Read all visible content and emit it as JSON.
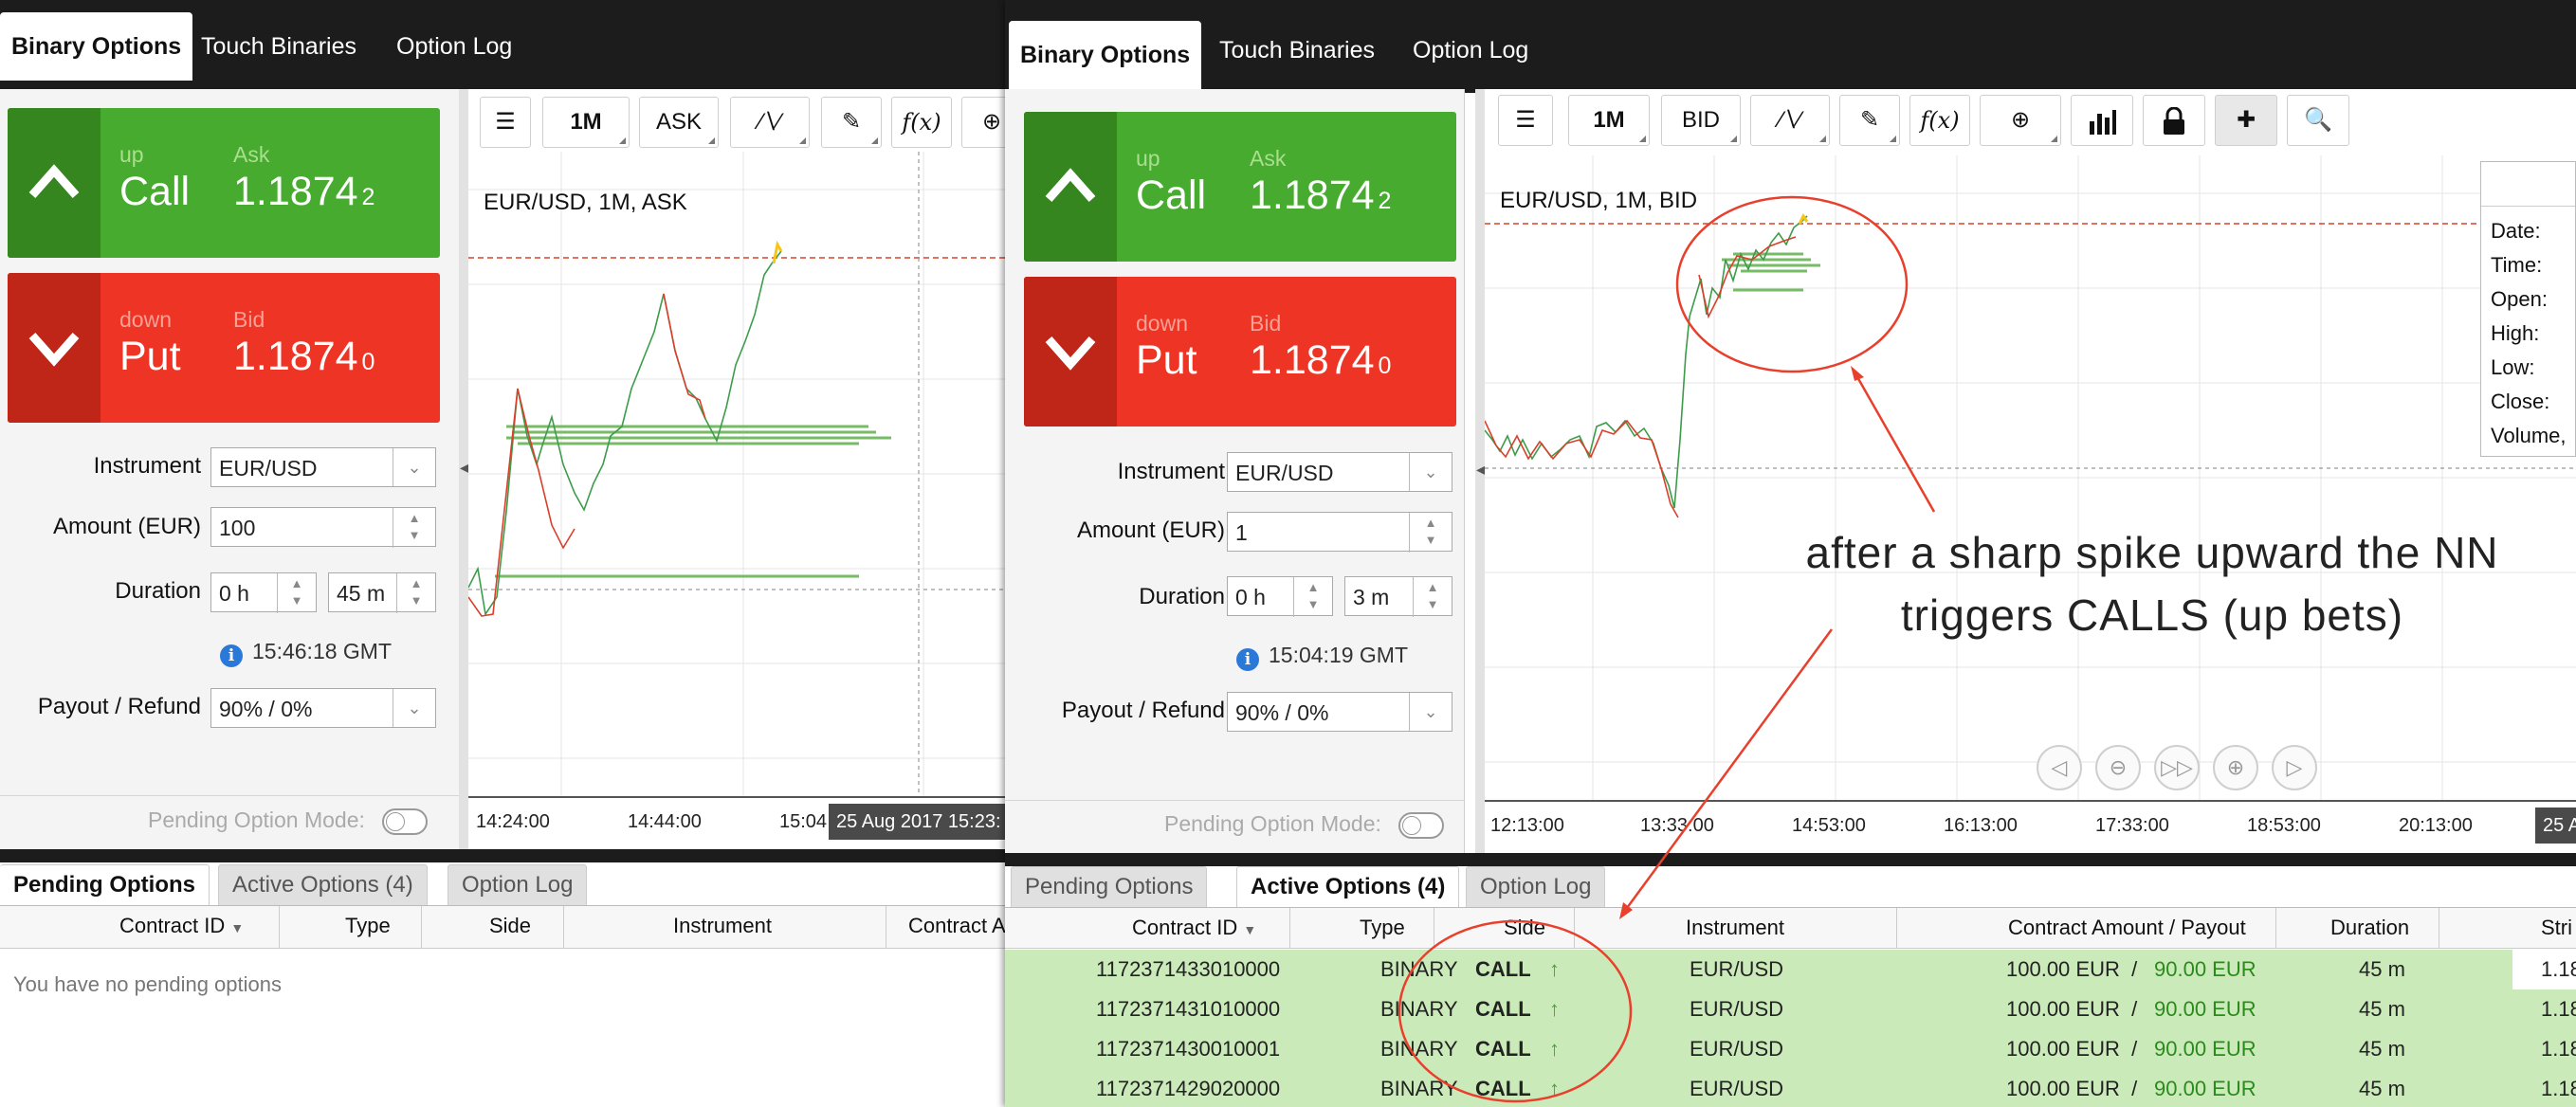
{
  "annotation": {
    "line1": "after a sharp spike upward the NN",
    "line2": "triggers CALLS (up  bets)"
  },
  "colors": {
    "call_green": "#46ab2e",
    "put_red": "#ee3424",
    "active_row": "#cbeaba",
    "annotation_red": "#e8402c"
  },
  "left": {
    "tabs": [
      "Binary Options",
      "Touch Binaries",
      "Option Log"
    ],
    "call": {
      "small_label": "up",
      "label": "Call",
      "price_label": "Ask",
      "price": "1.1874",
      "price_sub": "2"
    },
    "put": {
      "small_label": "down",
      "label": "Put",
      "price_label": "Bid",
      "price": "1.1874",
      "price_sub": "0"
    },
    "form": {
      "instrument_label": "Instrument",
      "instrument": "EUR/USD",
      "amount_label": "Amount (EUR)",
      "amount": "100",
      "duration_label": "Duration",
      "hours": "0 h",
      "minutes": "45 m",
      "time": "15:46:18 GMT",
      "payout_label": "Payout / Refund",
      "payout": "90% / 0%",
      "pending_mode": "Pending Option Mode:"
    },
    "chart": {
      "title": "EUR/USD, 1M, ASK",
      "toolbar": {
        "interval": "1M",
        "price_type": "ASK",
        "line_icon": "line-style-icon",
        "draw_icon": "pencil-icon",
        "func_label": "f(x)"
      },
      "x_labels": [
        "14:24:00",
        "14:44:00",
        "15:04"
      ],
      "date_box": "25 Aug 2017 15:23:"
    },
    "bottom": {
      "tabs": [
        "Pending Options",
        "Active Options (4)",
        "Option Log"
      ],
      "columns": [
        "Contract ID",
        "Type",
        "Side",
        "Instrument",
        "Contract A"
      ],
      "empty": "You have no pending options"
    }
  },
  "right": {
    "tabs": [
      "Binary Options",
      "Touch Binaries",
      "Option Log"
    ],
    "call": {
      "small_label": "up",
      "label": "Call",
      "price_label": "Ask",
      "price": "1.1874",
      "price_sub": "2"
    },
    "put": {
      "small_label": "down",
      "label": "Put",
      "price_label": "Bid",
      "price": "1.1874",
      "price_sub": "0"
    },
    "form": {
      "instrument_label": "Instrument",
      "instrument": "EUR/USD",
      "amount_label": "Amount (EUR)",
      "amount": "1",
      "duration_label": "Duration",
      "hours": "0 h",
      "minutes": "3 m",
      "time": "15:04:19 GMT",
      "payout_label": "Payout / Refund",
      "payout": "90% / 0%",
      "pending_mode": "Pending Option Mode:"
    },
    "chart": {
      "title": "EUR/USD, 1M, BID",
      "toolbar": {
        "interval": "1M",
        "price_type": "BID",
        "func_label": "f(x)"
      },
      "x_labels": [
        "12:13:00",
        "13:33:00",
        "14:53:00",
        "16:13:00",
        "17:33:00",
        "18:53:00",
        "20:13:00"
      ],
      "date_box": "25 A",
      "info_labels": [
        "Date:",
        "Time:",
        "Open:",
        "High:",
        "Low:",
        "Close:",
        "Volume,"
      ]
    },
    "bottom": {
      "tabs": [
        "Pending Options",
        "Active Options (4)",
        "Option Log"
      ],
      "columns": [
        "Contract ID",
        "Type",
        "Side",
        "Instrument",
        "Contract Amount / Payout",
        "Duration",
        "Stri"
      ],
      "rows": [
        {
          "id": "1172371433010000",
          "type": "BINARY",
          "side": "CALL",
          "instrument": "EUR/USD",
          "amount": "100.00 EUR",
          "payout": "90.00 EUR",
          "duration": "45 m",
          "strike": "1.18"
        },
        {
          "id": "1172371431010000",
          "type": "BINARY",
          "side": "CALL",
          "instrument": "EUR/USD",
          "amount": "100.00 EUR",
          "payout": "90.00 EUR",
          "duration": "45 m",
          "strike": "1.18"
        },
        {
          "id": "1172371430010001",
          "type": "BINARY",
          "side": "CALL",
          "instrument": "EUR/USD",
          "amount": "100.00 EUR",
          "payout": "90.00 EUR",
          "duration": "45 m",
          "strike": "1.18"
        },
        {
          "id": "1172371429020000",
          "type": "BINARY",
          "side": "CALL",
          "instrument": "EUR/USD",
          "amount": "100.00 EUR",
          "payout": "90.00 EUR",
          "duration": "45 m",
          "strike": "1.18"
        }
      ],
      "separator": " / "
    }
  }
}
